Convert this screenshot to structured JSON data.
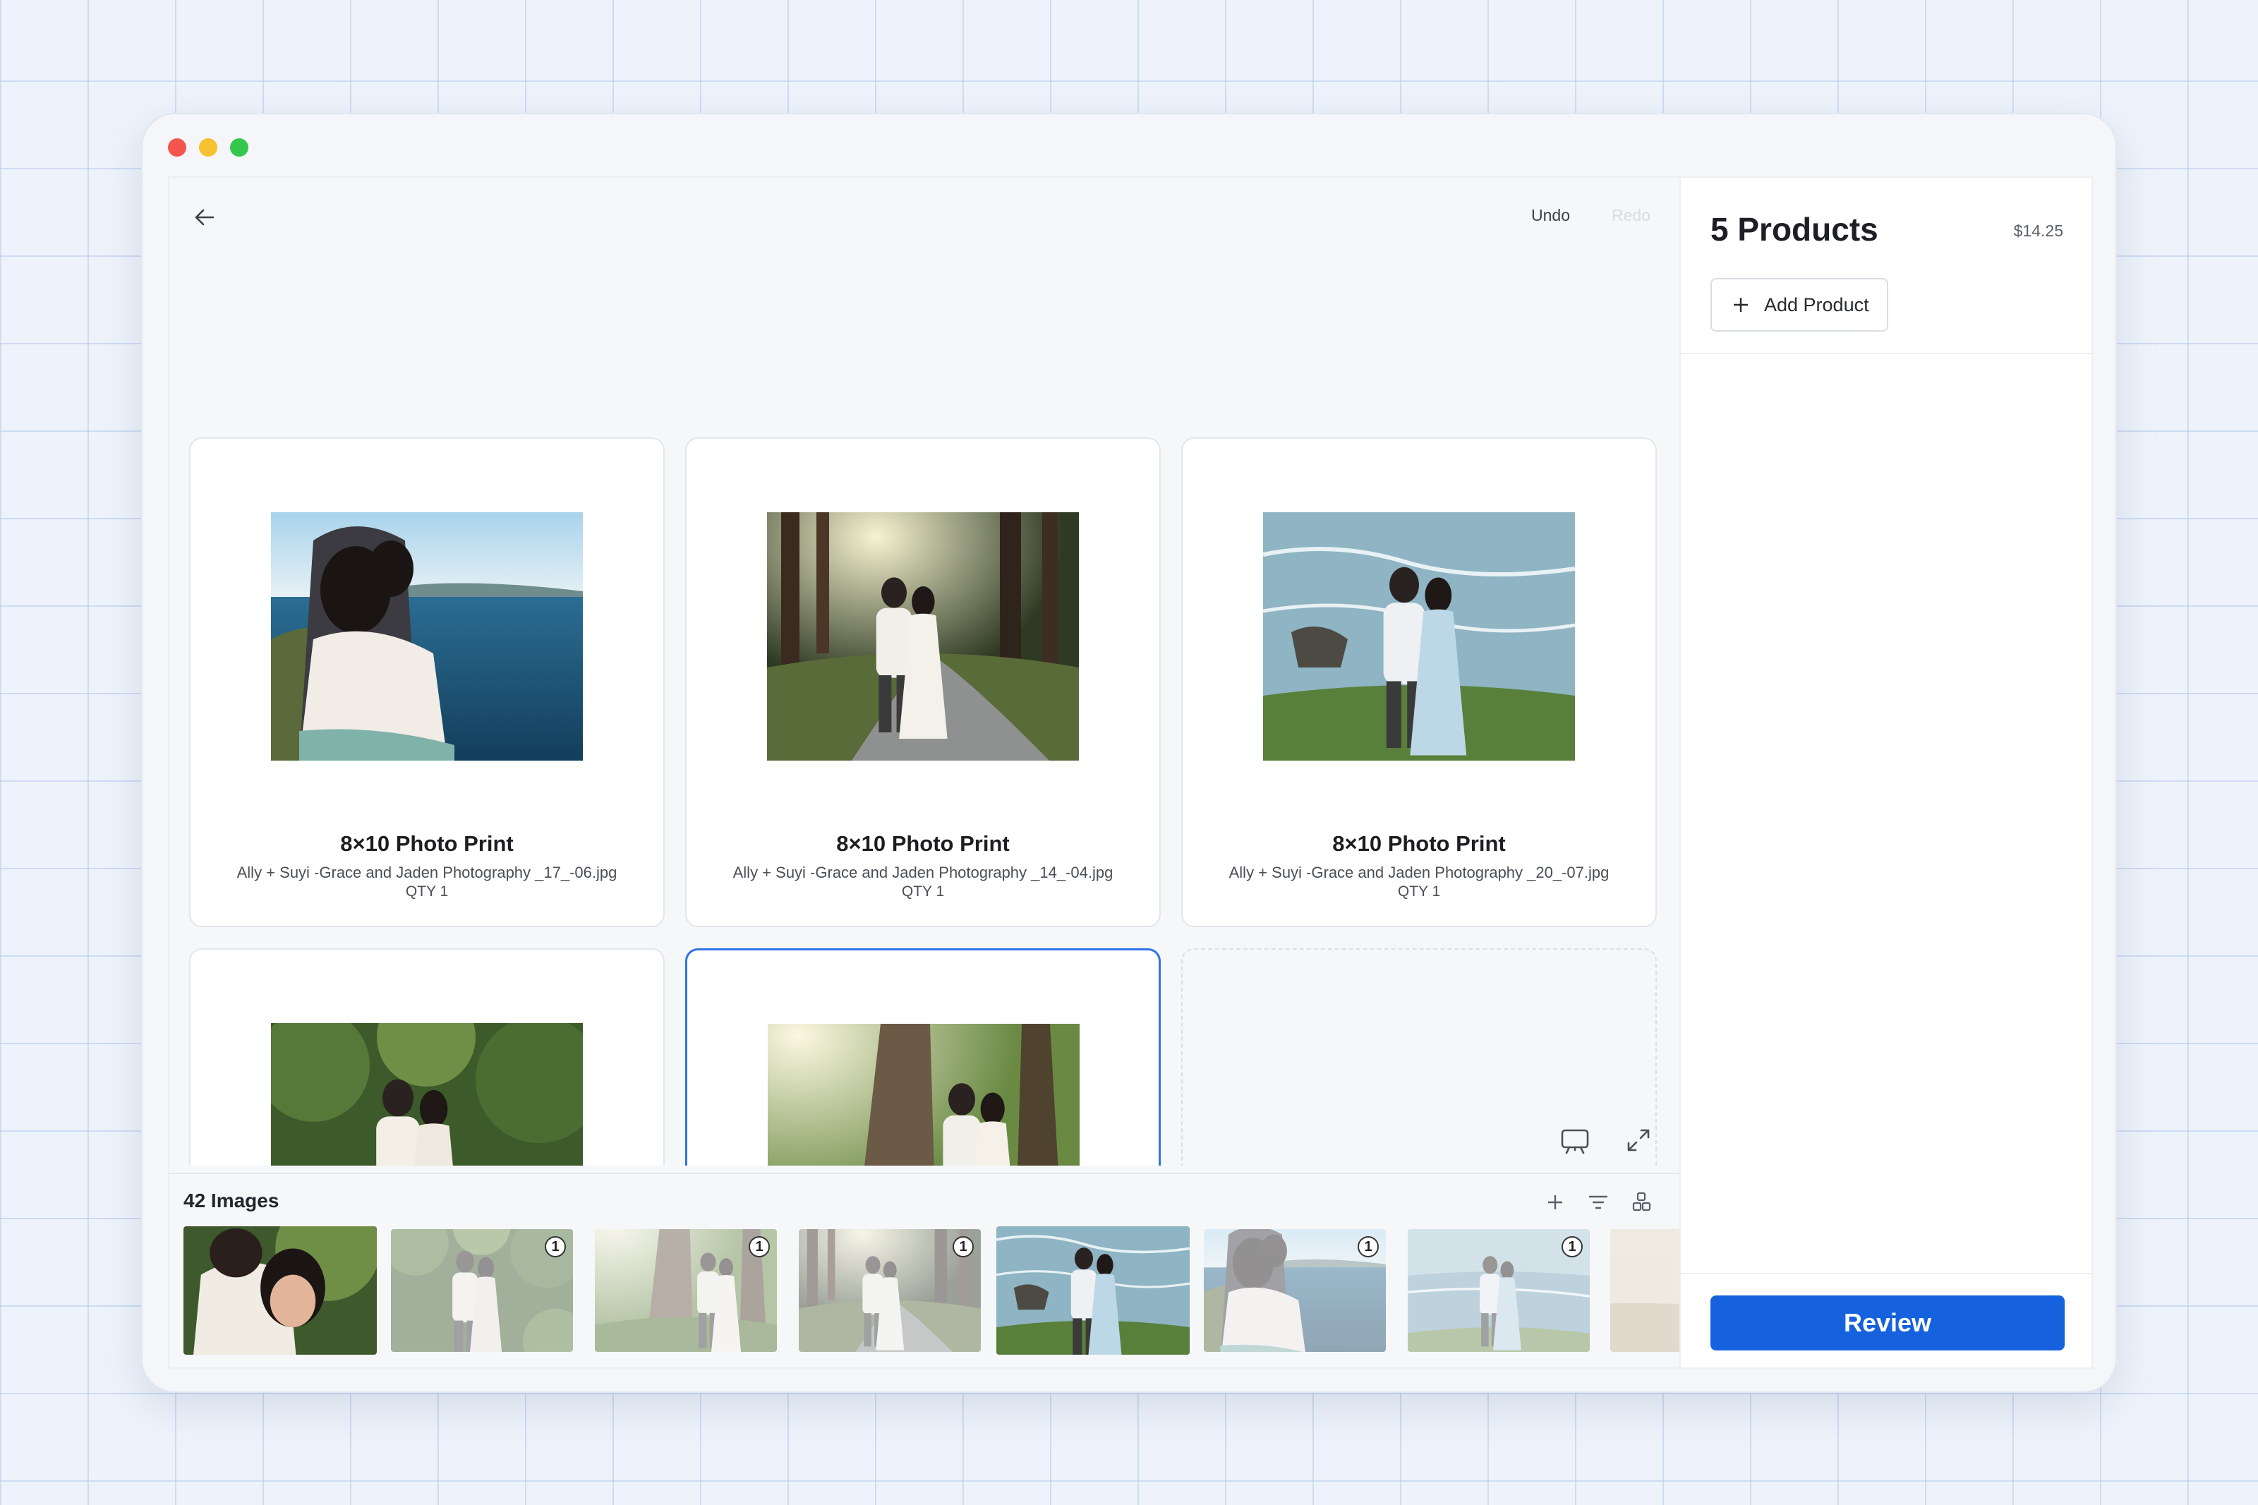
{
  "window": {
    "controls": [
      "close",
      "minimize",
      "maximize"
    ]
  },
  "toolbar": {
    "back_icon": "arrow-left-icon",
    "undo_label": "Undo",
    "redo_label": "Redo"
  },
  "products": [
    {
      "title": "8×10 Photo Print",
      "file": "Ally + Suyi -Grace and Jaden Photography _17_-06.jpg",
      "qty": "QTY 1",
      "scene": "coast-embrace"
    },
    {
      "title": "8×10 Photo Print",
      "file": "Ally + Suyi -Grace and Jaden Photography _14_-04.jpg",
      "qty": "QTY 1",
      "scene": "forest-road"
    },
    {
      "title": "8×10 Photo Print",
      "file": "Ally + Suyi -Grace and Jaden Photography _20_-07.jpg",
      "qty": "QTY 1",
      "scene": "sea-cliff"
    },
    {
      "title": "",
      "file": "",
      "qty": "",
      "scene": "garden-couple"
    },
    {
      "title": "",
      "file": "",
      "qty": "",
      "scene": "tree-kiss",
      "selected": true
    }
  ],
  "empty_slot": {
    "icon": "plus-icon"
  },
  "canvas_tools": {
    "present_icon": "presentation-icon",
    "expand_icon": "expand-icon"
  },
  "tray": {
    "title": "42 Images",
    "icons": [
      "plus-icon",
      "filter-icon",
      "sort-icon"
    ],
    "thumbnails": [
      {
        "scene": "laugh-closeup",
        "badge": "",
        "dim": false
      },
      {
        "scene": "garden-couple",
        "badge": "1",
        "dim": true
      },
      {
        "scene": "tree-kiss",
        "badge": "1",
        "dim": true
      },
      {
        "scene": "forest-road",
        "badge": "1",
        "dim": true
      },
      {
        "scene": "sea-cliff",
        "badge": "",
        "dim": false
      },
      {
        "scene": "coast-embrace",
        "badge": "1",
        "dim": true
      },
      {
        "scene": "beach-rocks",
        "badge": "1",
        "dim": true
      },
      {
        "scene": "sand-partial",
        "badge": "",
        "dim": true
      }
    ]
  },
  "sidebar": {
    "title": "5 Products",
    "price": "$14.25",
    "add_label": "Add Product",
    "review_label": "Review"
  },
  "colors": {
    "accent": "#1662de",
    "selected_border": "#2f74e6"
  }
}
